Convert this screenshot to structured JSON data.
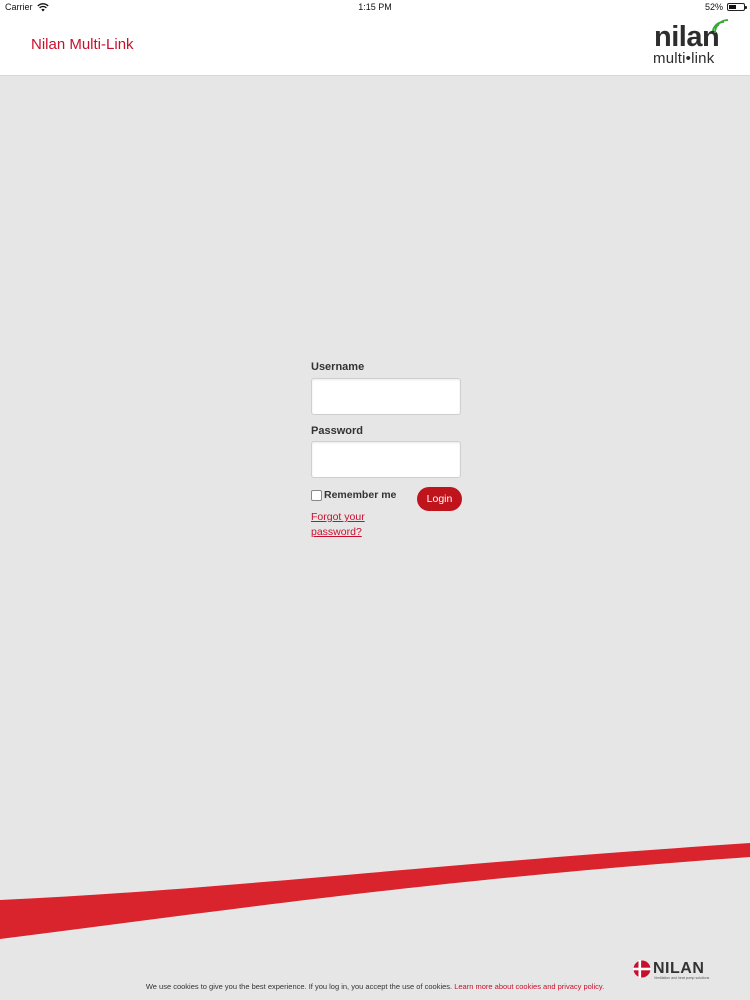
{
  "status_bar": {
    "carrier": "Carrier",
    "time": "1:15 PM",
    "battery_percent": "52%",
    "battery_level": 0.52
  },
  "header": {
    "title": "Nilan Multi-Link",
    "logo": {
      "line1": "nilan",
      "line2": "multi•link"
    }
  },
  "login": {
    "username_label": "Username",
    "username_value": "",
    "password_label": "Password",
    "password_value": "",
    "remember_label": "Remember me",
    "remember_checked": false,
    "login_button": "Login",
    "forgot_link": "Forgot your password?"
  },
  "footer": {
    "cookie_text": "We use cookies to give you the best experience. If you log in, you accept the use of cookies.",
    "cookie_link": "Learn more about cookies and privacy policy.",
    "brand": "NILAN",
    "brand_tagline": "Ventilation and heat pump solutions"
  },
  "colors": {
    "accent": "#c8102e",
    "button": "#c0141d",
    "background": "#e6e6e6"
  },
  "icons": [
    "wifi-icon",
    "battery-icon",
    "wifi-signal-icon",
    "danish-flag-icon"
  ]
}
